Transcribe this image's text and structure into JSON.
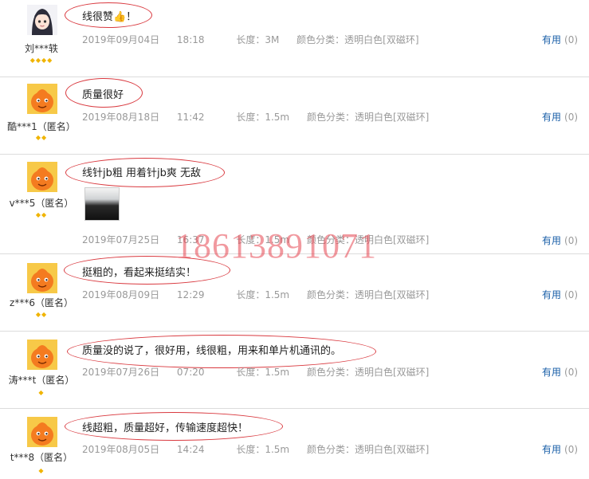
{
  "useful_label": "有用",
  "useful_count": "(0)",
  "watermark": "18613891071",
  "reviews": [
    {
      "username": "刘***轶",
      "text": "线很赞👍！",
      "date": "2019年09月04日",
      "time": "18:18",
      "length": "长度：3M",
      "color": "颜色分类：透明白色[双磁环]"
    },
    {
      "username": "酷***1（匿名）",
      "text": "质量很好",
      "date": "2019年08月18日",
      "time": "11:42",
      "length": "长度：1.5m",
      "color": "颜色分类：透明白色[双磁环]"
    },
    {
      "username": "v***5（匿名）",
      "text": "线针jb粗 用着针jb爽 无敌",
      "date": "2019年07月25日",
      "time": "16:37",
      "length": "长度：1.5m",
      "color": "颜色分类：透明白色[双磁环]"
    },
    {
      "username": "z***6（匿名）",
      "text": "挺粗的，看起来挺结实！",
      "date": "2019年08月09日",
      "time": "12:29",
      "length": "长度：1.5m",
      "color": "颜色分类：透明白色[双磁环]"
    },
    {
      "username": "涛***t（匿名）",
      "text": "质量没的说了，很好用，线很粗，用来和单片机通讯的。",
      "date": "2019年07月26日",
      "time": "07:20",
      "length": "长度：1.5m",
      "color": "颜色分类：透明白色[双磁环]"
    },
    {
      "username": "t***8（匿名）",
      "text": "线超粗，质量超好，传输速度超快！",
      "date": "2019年08月05日",
      "time": "14:24",
      "length": "长度：1.5m",
      "color": "颜色分类：透明白色[双磁环]"
    }
  ]
}
